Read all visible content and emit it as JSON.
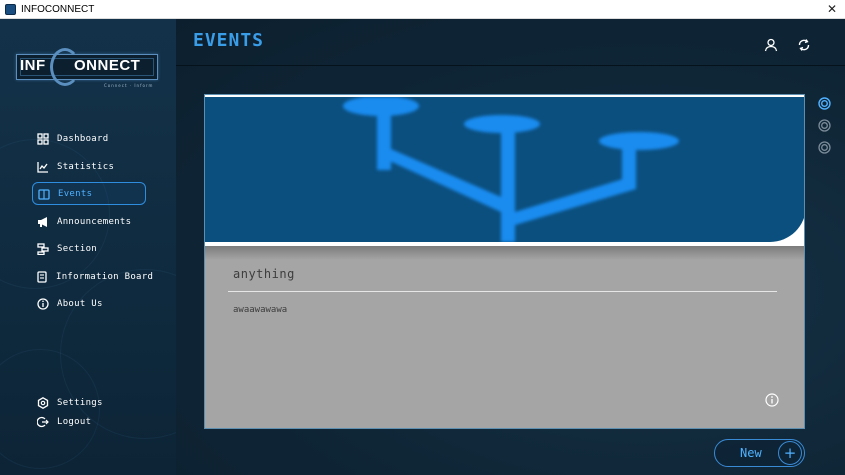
{
  "window": {
    "title": "INFOCONNECT",
    "close_glyph": "✕"
  },
  "logo": {
    "left_text": "INF",
    "right_text": "ONNECT",
    "tagline": "Connect · Inform"
  },
  "sidebar": {
    "items": [
      {
        "label": "Dashboard",
        "icon": "dashboard-icon"
      },
      {
        "label": "Statistics",
        "icon": "chart-icon"
      },
      {
        "label": "Events",
        "icon": "calendar-icon",
        "active": true
      },
      {
        "label": "Announcements",
        "icon": "megaphone-icon"
      },
      {
        "label": "Section",
        "icon": "section-icon"
      },
      {
        "label": "Information Board",
        "icon": "board-icon"
      },
      {
        "label": "About Us",
        "icon": "info-icon"
      }
    ],
    "bottom": [
      {
        "label": "Settings",
        "icon": "gear-icon"
      },
      {
        "label": "Logout",
        "icon": "logout-icon"
      }
    ]
  },
  "header": {
    "title": "EVENTS",
    "icons": [
      "user-icon",
      "refresh-icon"
    ]
  },
  "event_card": {
    "title": "anything",
    "description": "awaawawawa",
    "image_icon": "usb-symbol-icon"
  },
  "carousel": {
    "count": 3,
    "active_index": 0
  },
  "new_button": {
    "label": "New",
    "plus": "+"
  },
  "colors": {
    "accent": "#3a9de8",
    "sidebar_bg": "#13324a",
    "main_bg": "#0f2637",
    "card_bg": "#a5a5a5",
    "banner_bg": "#0b4f7e"
  }
}
